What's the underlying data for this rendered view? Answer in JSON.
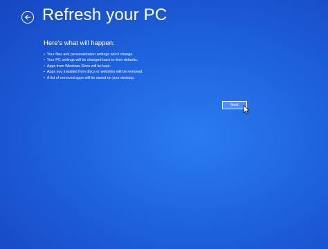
{
  "header": {
    "back_icon": "back-arrow-icon",
    "title": "Refresh your PC"
  },
  "content": {
    "subtitle": "Here's what will happen:",
    "items": [
      "Your files and personalization settings won't change.",
      "Your PC settings will be changed back to their defaults.",
      "Apps from Windows Store will be kept.",
      "Apps you installed from discs or websites will be removed.",
      "A list of removed apps will be saved on your desktop."
    ]
  },
  "actions": {
    "next_label": "Next"
  },
  "colors": {
    "background": "#1f63de",
    "text": "#ffffff",
    "button_fill": "#4f8eff"
  }
}
